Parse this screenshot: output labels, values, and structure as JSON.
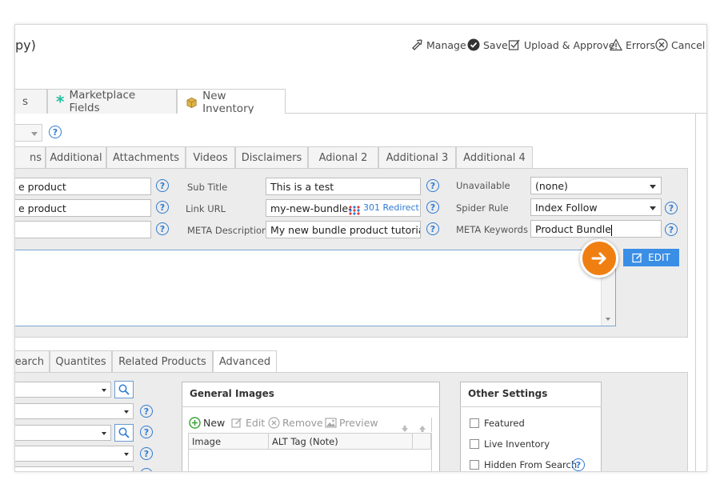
{
  "header": {
    "title": "py)",
    "toolbar": {
      "manage": "Manage",
      "save": "Save",
      "upload_approve": "Upload & Approve",
      "errors": "Errors",
      "cancel": "Cancel"
    }
  },
  "top_tabs": [
    {
      "label": "s"
    },
    {
      "label": "Marketplace Fields"
    },
    {
      "label": "New Inventory"
    }
  ],
  "inner_tabs": [
    "ns",
    "Additional",
    "Attachments",
    "Videos",
    "Disclaimers",
    "Adional 2",
    "Additional 3",
    "Additional 4"
  ],
  "form": {
    "col1": [
      "e product",
      "e product",
      ""
    ],
    "sub_title": {
      "label": "Sub Title",
      "value": "This is a test"
    },
    "link_url": {
      "label": "Link URL",
      "value": "my-new-bundle-",
      "redirect": "301 Redirect"
    },
    "meta_description": {
      "label": "META Description",
      "value": "My new bundle product tutorial"
    },
    "unavailable": {
      "label": "Unavailable",
      "value": "(none)"
    },
    "spider_rule": {
      "label": "Spider Rule",
      "value": "Index Follow"
    },
    "meta_keywords": {
      "label": "META Keywords",
      "value": "Product Bundle"
    },
    "edit_label": "EDIT"
  },
  "lower_tabs": [
    "earch",
    "Quantites",
    "Related Products",
    "Advanced"
  ],
  "general_images": {
    "title": "General Images",
    "new": "New",
    "edit": "Edit",
    "remove": "Remove",
    "preview": "Preview",
    "columns": [
      "Image",
      "ALT Tag (Note)"
    ]
  },
  "other_settings": {
    "title": "Other Settings",
    "items": [
      "Featured",
      "Live Inventory",
      "Hidden From Search"
    ]
  },
  "colors": {
    "accent_blue": "#2f7bd3",
    "edit_button": "#3a8ee6",
    "orange": "#f07f12",
    "teal_asterisk": "#1fbf9f"
  }
}
